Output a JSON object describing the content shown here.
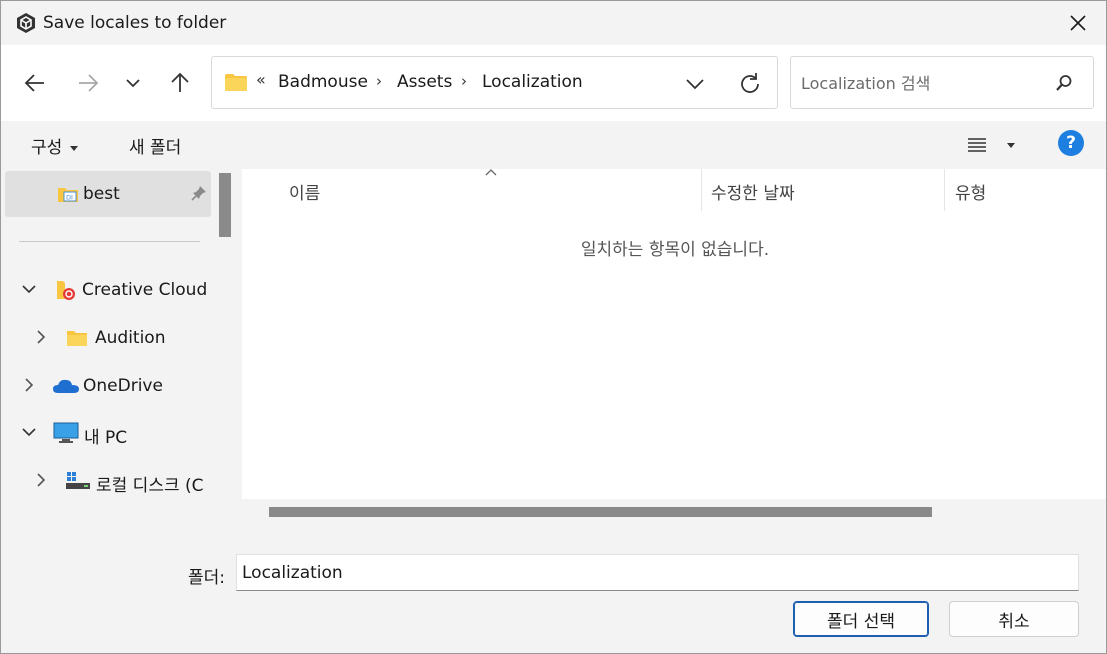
{
  "window": {
    "title": "Save locales to folder"
  },
  "nav": {
    "breadcrumb_overflow": "«",
    "breadcrumbs": [
      "Badmouse",
      "Assets",
      "Localization"
    ],
    "breadcrumb_sep": "›",
    "search_placeholder": "Localization 검색"
  },
  "commands": {
    "organize": "구성",
    "new_folder": "새 폴더",
    "help": "?"
  },
  "sidebar": {
    "items": [
      {
        "label": "best",
        "icon": "special-folder-icon",
        "pinned": true,
        "selected": true
      },
      {
        "label": "Creative Cloud F",
        "icon": "creative-cloud-folder-icon",
        "expanded": true
      },
      {
        "label": "Audition",
        "icon": "folder-icon",
        "expanded": false
      },
      {
        "label": "OneDrive",
        "icon": "onedrive-cloud-icon",
        "expanded": false
      },
      {
        "label": "내 PC",
        "icon": "monitor-icon",
        "expanded": true
      },
      {
        "label": "로컬 디스크 (C",
        "icon": "windows-drive-icon",
        "expanded": false
      }
    ]
  },
  "content": {
    "columns": [
      "이름",
      "수정한 날짜",
      "유형"
    ],
    "empty_message": "일치하는 항목이 없습니다."
  },
  "bottom": {
    "folder_label": "폴더:",
    "folder_value": "Localization",
    "select_button": "폴더 선택",
    "cancel_button": "취소"
  },
  "colors": {
    "accent": "#1d7fe0",
    "folder_yellow": "#f8c640",
    "primary_border": "#1d5fae"
  }
}
